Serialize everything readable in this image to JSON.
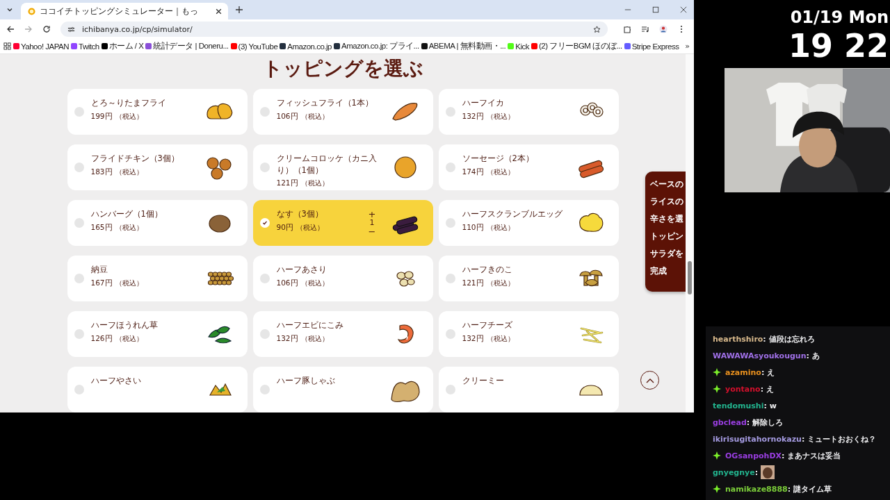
{
  "browser": {
    "tab": {
      "title": "ココイチトッピングシミュレーター｜もっ"
    },
    "address": {
      "url": "ichibanya.co.jp/cp/simulator/"
    },
    "bookmarks": [
      {
        "label": "Yahoo! JAPAN",
        "color": "#ff0033"
      },
      {
        "label": "Twitch",
        "color": "#9146ff"
      },
      {
        "label": "ホーム / X",
        "color": "#000000"
      },
      {
        "label": "統計データ | Doneru...",
        "color": "#8a4fd8"
      },
      {
        "label": "(3) YouTube",
        "color": "#ff0000"
      },
      {
        "label": "Amazon.co.jp",
        "color": "#232f3e"
      },
      {
        "label": "Amazon.co.jp: プライ...",
        "color": "#232f3e"
      },
      {
        "label": "ABEMA | 無料動画・...",
        "color": "#111111"
      },
      {
        "label": "Kick",
        "color": "#53fc18"
      },
      {
        "label": "(2) フリーBGM ほのぼ...",
        "color": "#ff0000"
      },
      {
        "label": "Stripe Express",
        "color": "#635bff"
      }
    ],
    "bookmarks_more": "»"
  },
  "page": {
    "heading": "トッピングを選ぶ",
    "toppings": [
      {
        "name": "とろ～りたまフライ",
        "price": "199円",
        "tax": "（税込）",
        "selected": false
      },
      {
        "name": "フィッシュフライ（1本）",
        "price": "106円",
        "tax": "（税込）",
        "selected": false
      },
      {
        "name": "ハーフイカ",
        "price": "132円",
        "tax": "（税込）",
        "selected": false
      },
      {
        "name": "フライドチキン（3個）",
        "price": "183円",
        "tax": "（税込）",
        "selected": false
      },
      {
        "name": "クリームコロッケ（カニ入り）（1個）",
        "price": "121円",
        "tax": "（税込）",
        "selected": false
      },
      {
        "name": "ソーセージ（2本）",
        "price": "174円",
        "tax": "（税込）",
        "selected": false
      },
      {
        "name": "ハンバーグ（1個）",
        "price": "165円",
        "tax": "（税込）",
        "selected": false
      },
      {
        "name": "なす（3個）",
        "price": "90円",
        "tax": "（税込）",
        "selected": true,
        "increment": "+",
        "quantity": "1",
        "decrement": "−"
      },
      {
        "name": "ハーフスクランブルエッグ",
        "price": "110円",
        "tax": "（税込）",
        "selected": false
      },
      {
        "name": "納豆",
        "price": "167円",
        "tax": "（税込）",
        "selected": false
      },
      {
        "name": "ハーフあさり",
        "price": "106円",
        "tax": "（税込）",
        "selected": false
      },
      {
        "name": "ハーフきのこ",
        "price": "121円",
        "tax": "（税込）",
        "selected": false
      },
      {
        "name": "ハーフほうれん草",
        "price": "126円",
        "tax": "（税込）",
        "selected": false
      },
      {
        "name": "ハーフエビにこみ",
        "price": "132円",
        "tax": "（税込）",
        "selected": false
      },
      {
        "name": "ハーフチーズ",
        "price": "132円",
        "tax": "（税込）",
        "selected": false
      },
      {
        "name": "ハーフやさい",
        "selected": false
      },
      {
        "name": "ハーフ豚しゃぶ",
        "selected": false
      },
      {
        "name": "クリーミー",
        "selected": false
      }
    ],
    "nav": [
      {
        "label": "ベースの"
      },
      {
        "label": "ライスの"
      },
      {
        "label": "辛さを選"
      },
      {
        "label": "トッピン"
      },
      {
        "label": "サラダを"
      },
      {
        "label": "完成"
      }
    ]
  },
  "stream": {
    "date": "01/19 Mon",
    "time": "19 22",
    "chat": [
      {
        "user": "hearthshiro",
        "color": "#d8b98c",
        "badge": false,
        "text": ": 値段は忘れろ"
      },
      {
        "user": "WAWAWAsyoukougun",
        "color": "#a070e8",
        "badge": false,
        "text": ": あ"
      },
      {
        "user": "azamino",
        "color": "#e8901e",
        "badge": true,
        "text": ": え"
      },
      {
        "user": "yontano",
        "color": "#d4102c",
        "badge": true,
        "text": ": え"
      },
      {
        "user": "tendomushi",
        "color": "#22b48e",
        "badge": false,
        "text": ": w"
      },
      {
        "user": "gbclead",
        "color": "#9a3ee2",
        "badge": false,
        "text": ": 解除しろ"
      },
      {
        "user": "ikirisugitahornokazu",
        "color": "#a49ae0",
        "badge": false,
        "text": ": ミュートおおくね？"
      },
      {
        "user": "OGsanpohDX",
        "color": "#9a3ee2",
        "badge": true,
        "text": ": まあナスは妥当"
      },
      {
        "user": "gnyegnye",
        "color": "#22b48e",
        "badge": false,
        "text": ":",
        "emote": true
      },
      {
        "user": "namikaze8888",
        "color": "#7ccf3a",
        "badge": true,
        "text": ": 謎タイム草"
      }
    ]
  }
}
